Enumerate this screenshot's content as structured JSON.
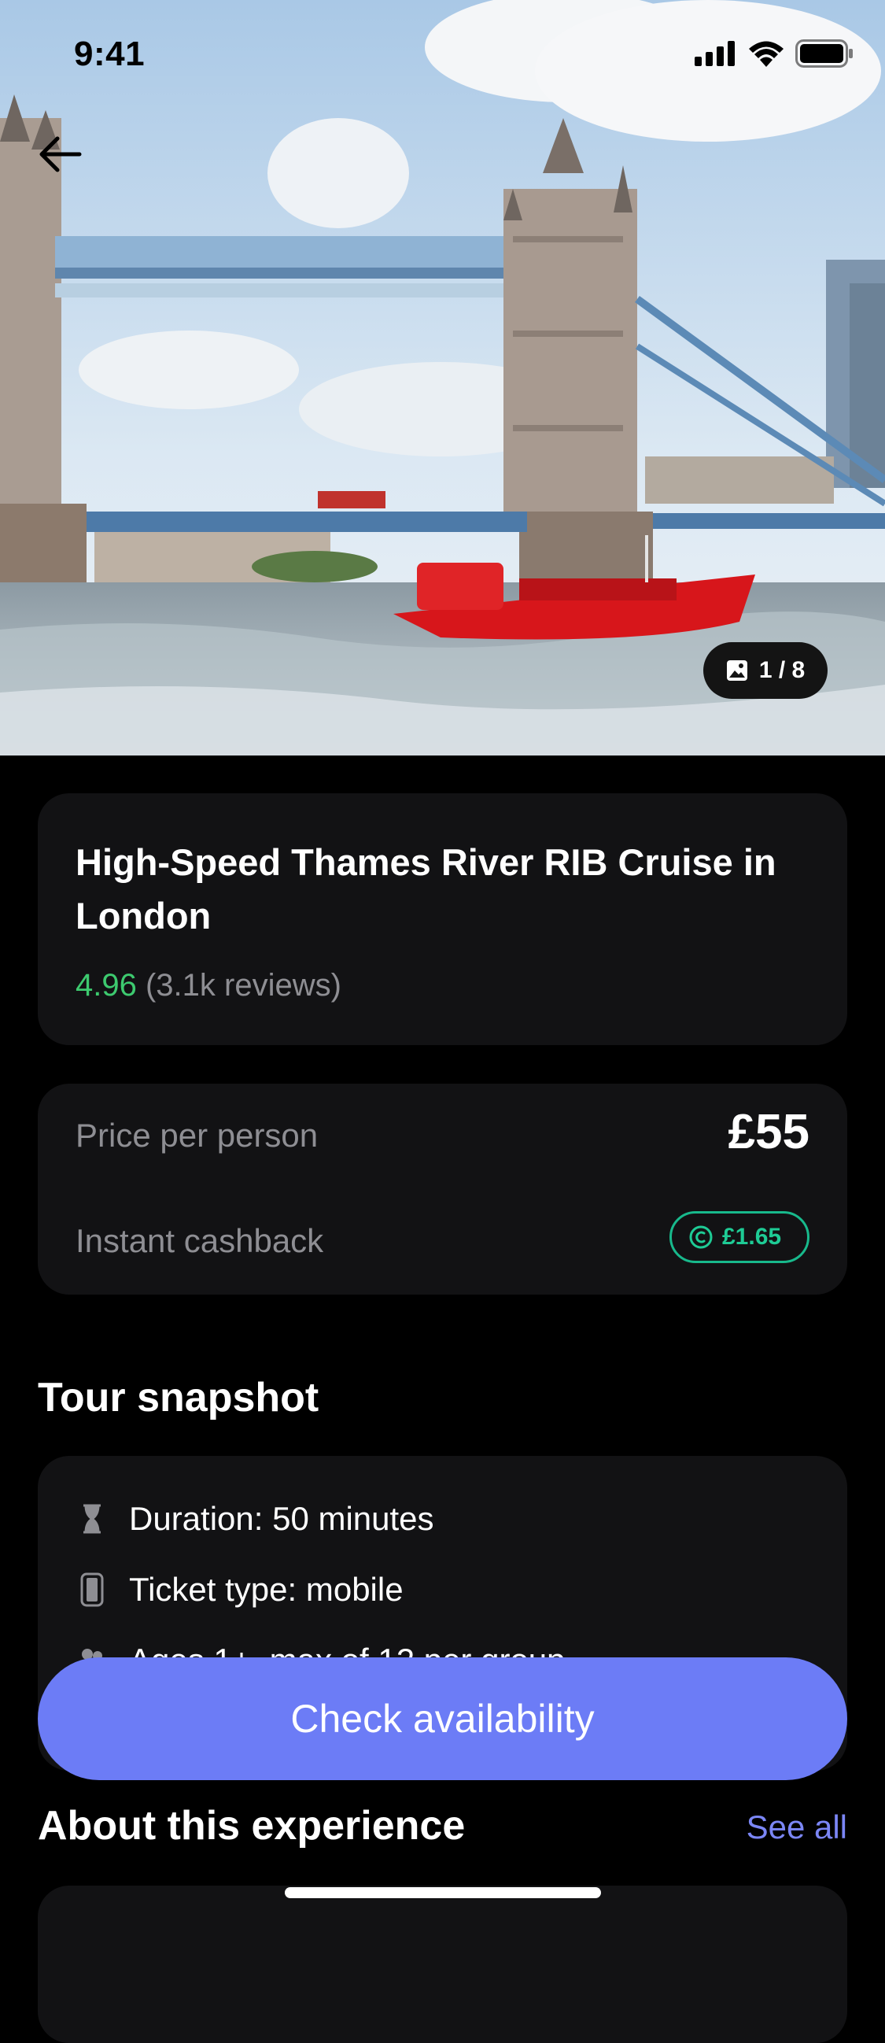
{
  "status_bar": {
    "time": "9:41"
  },
  "hero": {
    "photo_counter": "1 / 8"
  },
  "tour": {
    "title": "High-Speed Thames River RIB Cruise in London",
    "rating": "4.96",
    "reviews": "(3.1k reviews)"
  },
  "pricing": {
    "price_label": "Price per person",
    "price_value": "£55",
    "cashback_label": "Instant cashback",
    "cashback_value": "£1.65"
  },
  "snapshot": {
    "title": "Tour snapshot",
    "items": [
      {
        "icon": "hourglass-icon",
        "text": "Duration: 50 minutes"
      },
      {
        "icon": "phone-ticket-icon",
        "text": "Ticket type: mobile"
      },
      {
        "icon": "group-icon",
        "text": "Ages 1+, max of 12 per group"
      }
    ]
  },
  "cta": {
    "label": "Check availability"
  },
  "about": {
    "title": "About this experience",
    "see_all": "See all"
  },
  "colors": {
    "accent": "#6c7cf6",
    "rating_green": "#3dca6f",
    "cashback_teal": "#1ecb95",
    "card_bg": "#121214"
  }
}
